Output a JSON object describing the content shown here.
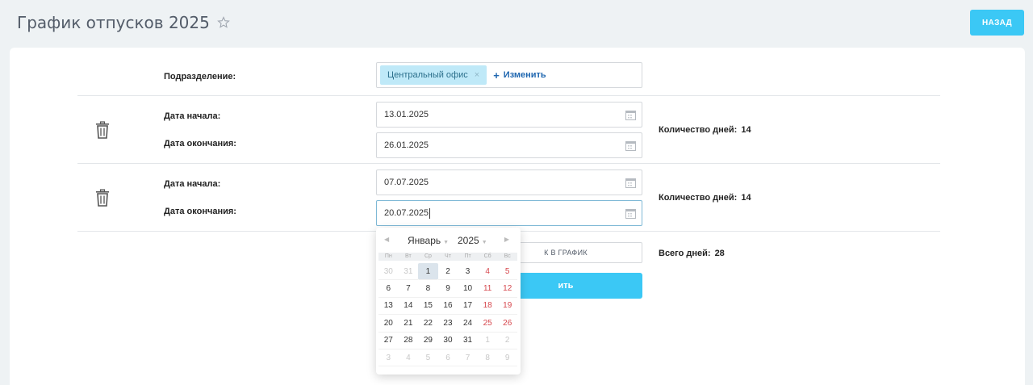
{
  "header": {
    "title": "График отпусков 2025",
    "back_label": "НАЗАД"
  },
  "department": {
    "label": "Подразделение:",
    "chip": "Центральный офис",
    "chip_close": "×",
    "change_label": "Изменить"
  },
  "periods": [
    {
      "start_label": "Дата начала:",
      "end_label": "Дата окончания:",
      "start": "13.01.2025",
      "end": "26.01.2025",
      "days_label": "Количество дней:",
      "days": "14"
    },
    {
      "start_label": "Дата начала:",
      "end_label": "Дата окончания:",
      "start": "07.07.2025",
      "end": "20.07.2025",
      "days_label": "Количество дней:",
      "days": "14"
    }
  ],
  "total": {
    "label": "Всего дней:",
    "value": "28"
  },
  "buttons": {
    "add": "К В ГРАФИК",
    "save": "ить"
  },
  "calendar": {
    "month": "Январь",
    "year": "2025",
    "weekdays": [
      "Пн",
      "Вт",
      "Ср",
      "Чт",
      "Пт",
      "Сб",
      "Вс"
    ],
    "weeks": [
      [
        "30",
        "31",
        "1",
        "2",
        "3",
        "4",
        "5"
      ],
      [
        "6",
        "7",
        "8",
        "9",
        "10",
        "11",
        "12"
      ],
      [
        "13",
        "14",
        "15",
        "16",
        "17",
        "18",
        "19"
      ],
      [
        "20",
        "21",
        "22",
        "23",
        "24",
        "25",
        "26"
      ],
      [
        "27",
        "28",
        "29",
        "30",
        "31",
        "1",
        "2"
      ],
      [
        "3",
        "4",
        "5",
        "6",
        "7",
        "8",
        "9"
      ]
    ],
    "selected": "1"
  },
  "colors": {
    "accent": "#3bc8f5",
    "weekend": "#d6474d",
    "link": "#2067b0"
  },
  "icons": {
    "favorite": "star-icon",
    "delete": "trash-icon",
    "calendar": "calendar-icon"
  }
}
